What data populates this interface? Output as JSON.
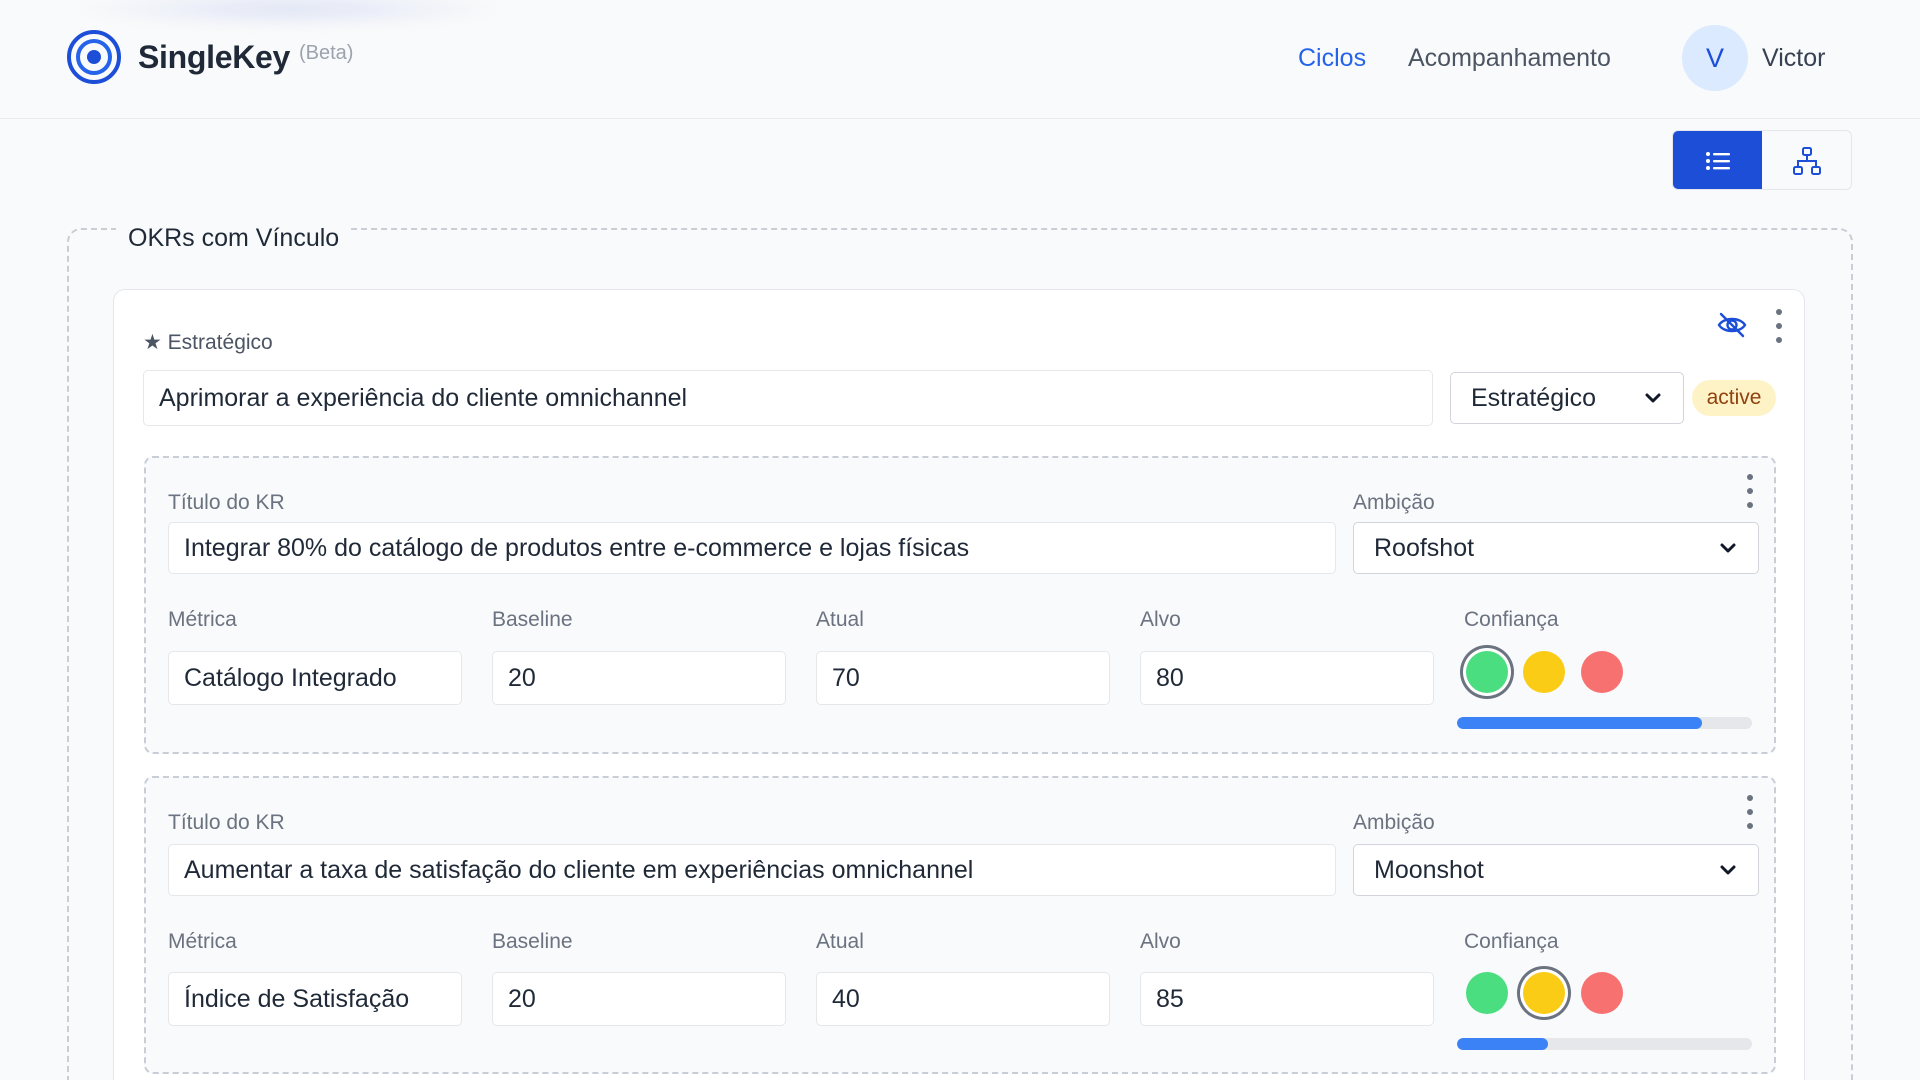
{
  "app": {
    "name": "SingleKey",
    "beta": "(Beta)"
  },
  "nav": {
    "ciclos": "Ciclos",
    "acompanhamento": "Acompanhamento"
  },
  "user": {
    "initial": "V",
    "name": "Victor"
  },
  "icons": {
    "list_view": "list-icon",
    "tree_view": "hierarchy-icon",
    "visibility": "eye-off-icon",
    "menu": "kebab-menu-icon"
  },
  "colors": {
    "accent": "#2563eb",
    "active_toggle": "#1d4ed8",
    "badge_bg": "#fef3c7",
    "green": "#4ade80",
    "yellow": "#facc15",
    "red": "#f87171"
  },
  "section": {
    "title": "OKRs com Vínculo"
  },
  "objective": {
    "label": "★ Estratégico",
    "title": "Aprimorar a experiência do cliente omnichannel",
    "type": "Estratégico",
    "status": "active"
  },
  "labels": {
    "kr_title": "Título do KR",
    "ambition": "Ambição",
    "metric": "Métrica",
    "baseline": "Baseline",
    "current": "Atual",
    "target": "Alvo",
    "confidence": "Confiança"
  },
  "key_results": [
    {
      "title": "Integrar 80% do catálogo de produtos entre e-commerce e lojas físicas",
      "ambition": "Roofshot",
      "metric": "Catálogo Integrado",
      "baseline": "20",
      "current": "70",
      "target": "80",
      "confidence": "green",
      "progress_percent": 83
    },
    {
      "title": "Aumentar a taxa de satisfação do cliente em experiências omnichannel",
      "ambition": "Moonshot",
      "metric": "Índice de Satisfação",
      "baseline": "20",
      "current": "40",
      "target": "85",
      "confidence": "yellow",
      "progress_percent": 31
    }
  ]
}
